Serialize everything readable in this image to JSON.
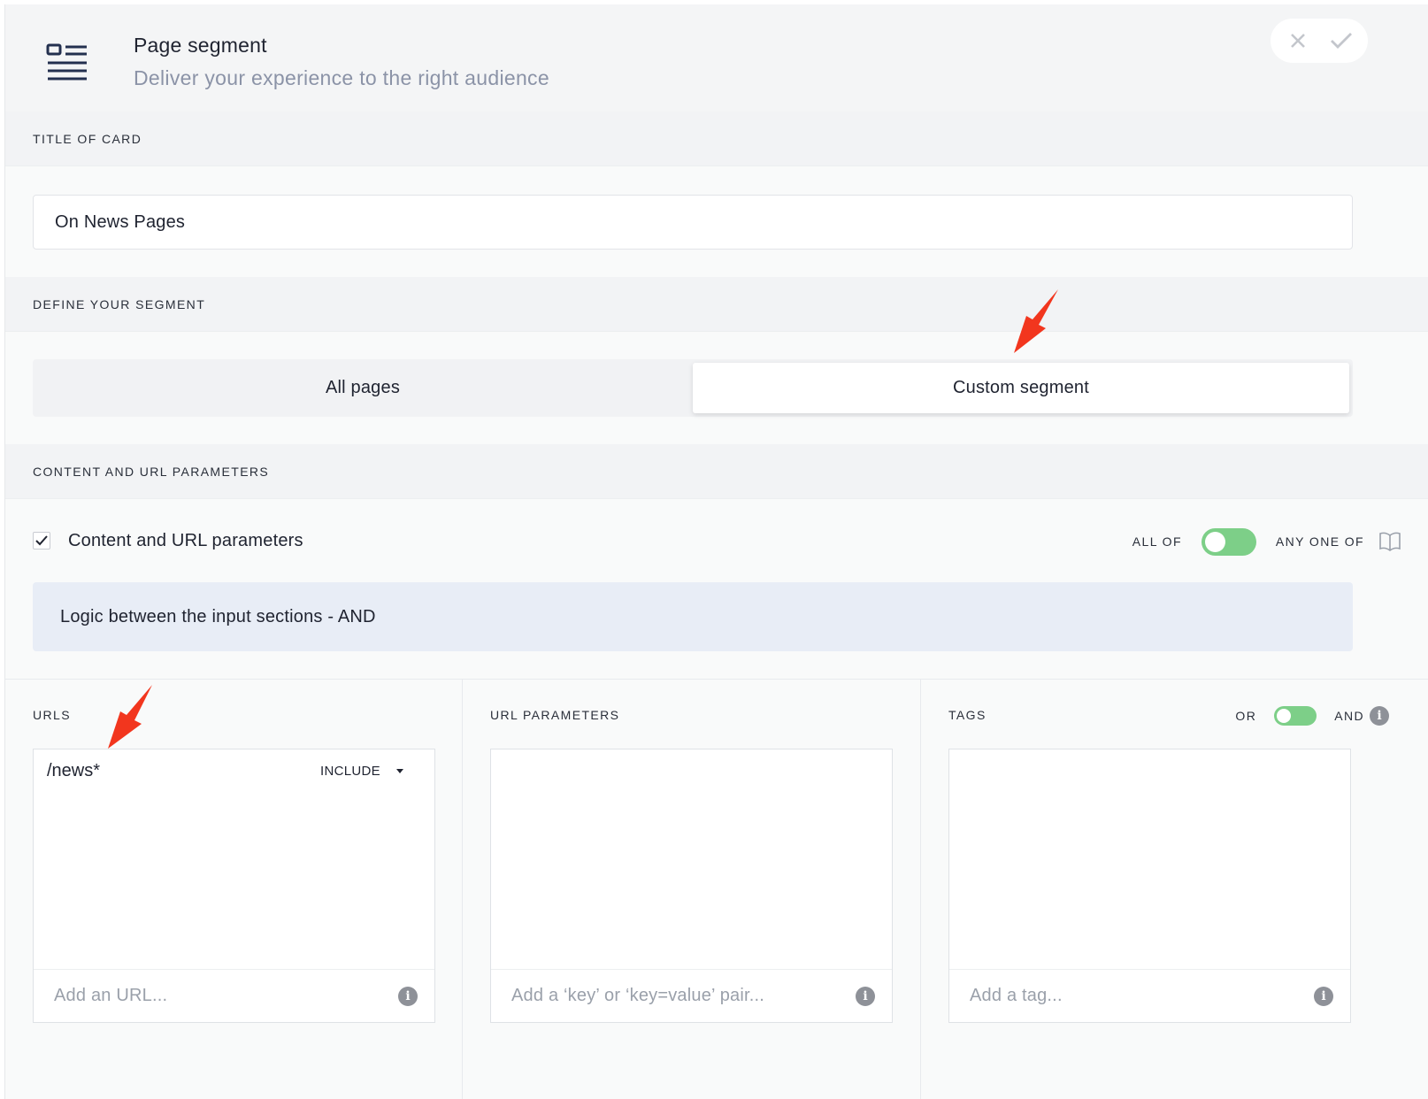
{
  "header": {
    "title": "Page segment",
    "subtitle": "Deliver your experience to the right audience",
    "icon": "layout-list-icon",
    "close_icon": "close-icon",
    "confirm_icon": "check-icon"
  },
  "sections": {
    "title_of_card": {
      "label": "TITLE OF CARD",
      "value": "On News Pages"
    },
    "define_segment": {
      "label": "DEFINE YOUR SEGMENT",
      "options": [
        "All pages",
        "Custom segment"
      ],
      "selected": "Custom segment"
    },
    "content_url": {
      "label": "CONTENT AND URL PARAMETERS",
      "checkbox_label": "Content and URL parameters",
      "checked": true,
      "toggle_left": "ALL OF",
      "toggle_right": "ANY ONE OF",
      "banner": "Logic between the input sections - AND"
    }
  },
  "columns": {
    "urls": {
      "label": "URLS",
      "entries": [
        {
          "value": "/news*",
          "mode": "INCLUDE"
        }
      ],
      "placeholder": "Add an URL..."
    },
    "url_parameters": {
      "label": "URL PARAMETERS",
      "placeholder": "Add a ‘key’ or ‘key=value’ pair..."
    },
    "tags": {
      "label": "TAGS",
      "toggle_left": "OR",
      "toggle_right": "AND",
      "placeholder": "Add a tag..."
    }
  },
  "colors": {
    "accent_green": "#7dcf88",
    "banner_bg": "#e8edf6",
    "annotation_arrow": "#f2361e"
  }
}
